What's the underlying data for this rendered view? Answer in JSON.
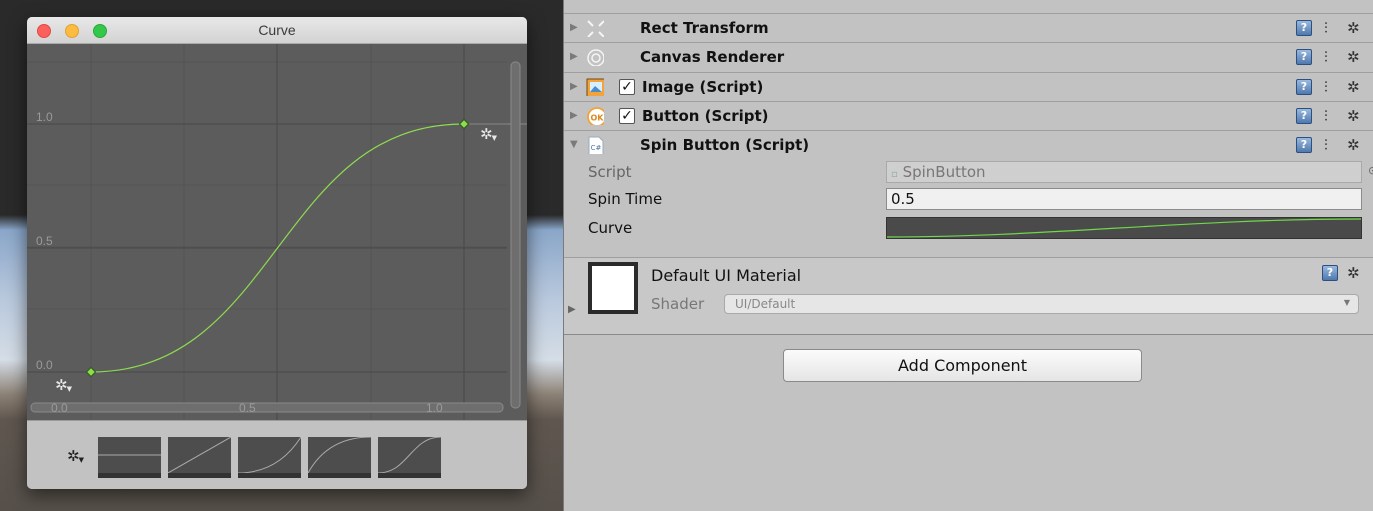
{
  "curve_window": {
    "title": "Curve",
    "y_ticks": [
      "1.0",
      "0.5",
      "0.0"
    ],
    "x_ticks": [
      "0.0",
      "0.5",
      "1.0"
    ],
    "keyframes": [
      {
        "time": 0.0,
        "value": 0.0
      },
      {
        "time": 1.0,
        "value": 1.0
      }
    ],
    "curve_color": "#8edc4f",
    "presets": [
      "constant",
      "linear",
      "ease-in",
      "ease-out",
      "ease-in-out"
    ]
  },
  "inspector": {
    "components": [
      {
        "label": "Rect Transform",
        "icon": "rect-transform-icon",
        "checkbox": false
      },
      {
        "label": "Canvas Renderer",
        "icon": "canvas-renderer-icon",
        "checkbox": false
      },
      {
        "label": "Image (Script)",
        "icon": "image-icon",
        "checkbox": true
      },
      {
        "label": "Button (Script)",
        "icon": "button-icon",
        "checkbox": true
      },
      {
        "label": "Spin Button (Script)",
        "icon": "csharp-script-icon",
        "checkbox": false
      }
    ],
    "help_glyph": "?",
    "properties": {
      "script_label": "Script",
      "script_value": "SpinButton",
      "spin_time_label": "Spin Time",
      "spin_time_value": "0.5",
      "curve_label": "Curve"
    },
    "material": {
      "name": "Default UI Material",
      "shader_label": "Shader",
      "shader_value": "UI/Default"
    },
    "add_component_label": "Add Component"
  }
}
